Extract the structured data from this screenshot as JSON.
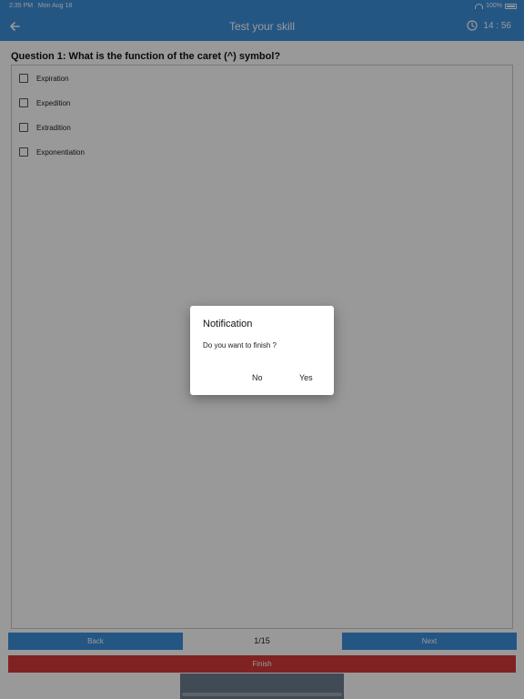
{
  "status_bar": {
    "time": "2:35 PM",
    "date": "Mon Aug 18",
    "battery": "100%"
  },
  "app_bar": {
    "title": "Test your skill",
    "timer": "14 : 56"
  },
  "question": {
    "text": "Question 1: What is the function of the caret (^) symbol?"
  },
  "options": [
    {
      "label": "Expiration"
    },
    {
      "label": "Expedition"
    },
    {
      "label": "Extradition"
    },
    {
      "label": "Exponentiation"
    }
  ],
  "navigation": {
    "back_label": "Back",
    "page": "1/15",
    "next_label": "Next",
    "finish_label": "Finish"
  },
  "dialog": {
    "title": "Notification",
    "message": "Do you want to finish ?",
    "no_label": "No",
    "yes_label": "Yes"
  },
  "colors": {
    "primary": "#3d8fdc",
    "finish": "#d63a3a",
    "overlay": "rgba(0,0,0,0.4)"
  }
}
